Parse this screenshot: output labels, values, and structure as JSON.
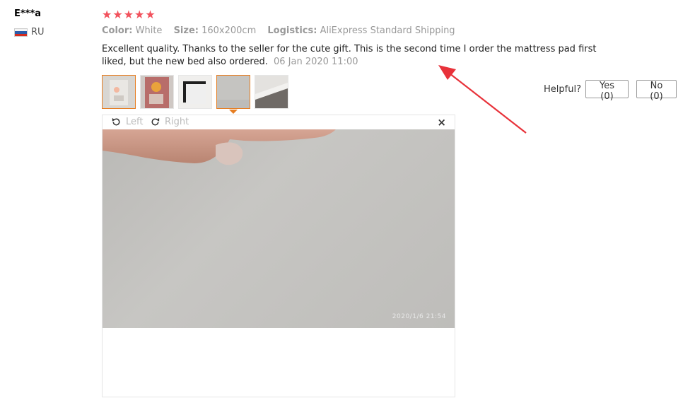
{
  "reviewer": {
    "name": "E***a",
    "country": "RU",
    "flag_colors": [
      "#ffffff",
      "#2a5caa",
      "#d52b1e"
    ]
  },
  "rating": {
    "stars": 5,
    "max": 5,
    "glyph": "★",
    "color": "#f2525d"
  },
  "attributes": [
    {
      "label": "Color:",
      "value": "White"
    },
    {
      "label": "Size:",
      "value": "160x200cm"
    },
    {
      "label": "Logistics:",
      "value": "AliExpress Standard Shipping"
    }
  ],
  "review": {
    "text": "Excellent quality. Thanks to the seller for the cute gift. This is the second time I order the mattress pad first liked, but the new bed also ordered.",
    "date": "06 Jan 2020 11:00"
  },
  "thumbnails": {
    "count": 5,
    "active_index": 3,
    "active_color": "#e67e22"
  },
  "viewer": {
    "rotate_left": "Left",
    "rotate_right": "Right",
    "close": "×",
    "photo_timestamp": "2020/1/6  21:54"
  },
  "helpful": {
    "label": "Helpful?",
    "yes": "Yes (0)",
    "no": "No (0)"
  },
  "annotation": {
    "arrow_color": "#e8323a"
  }
}
